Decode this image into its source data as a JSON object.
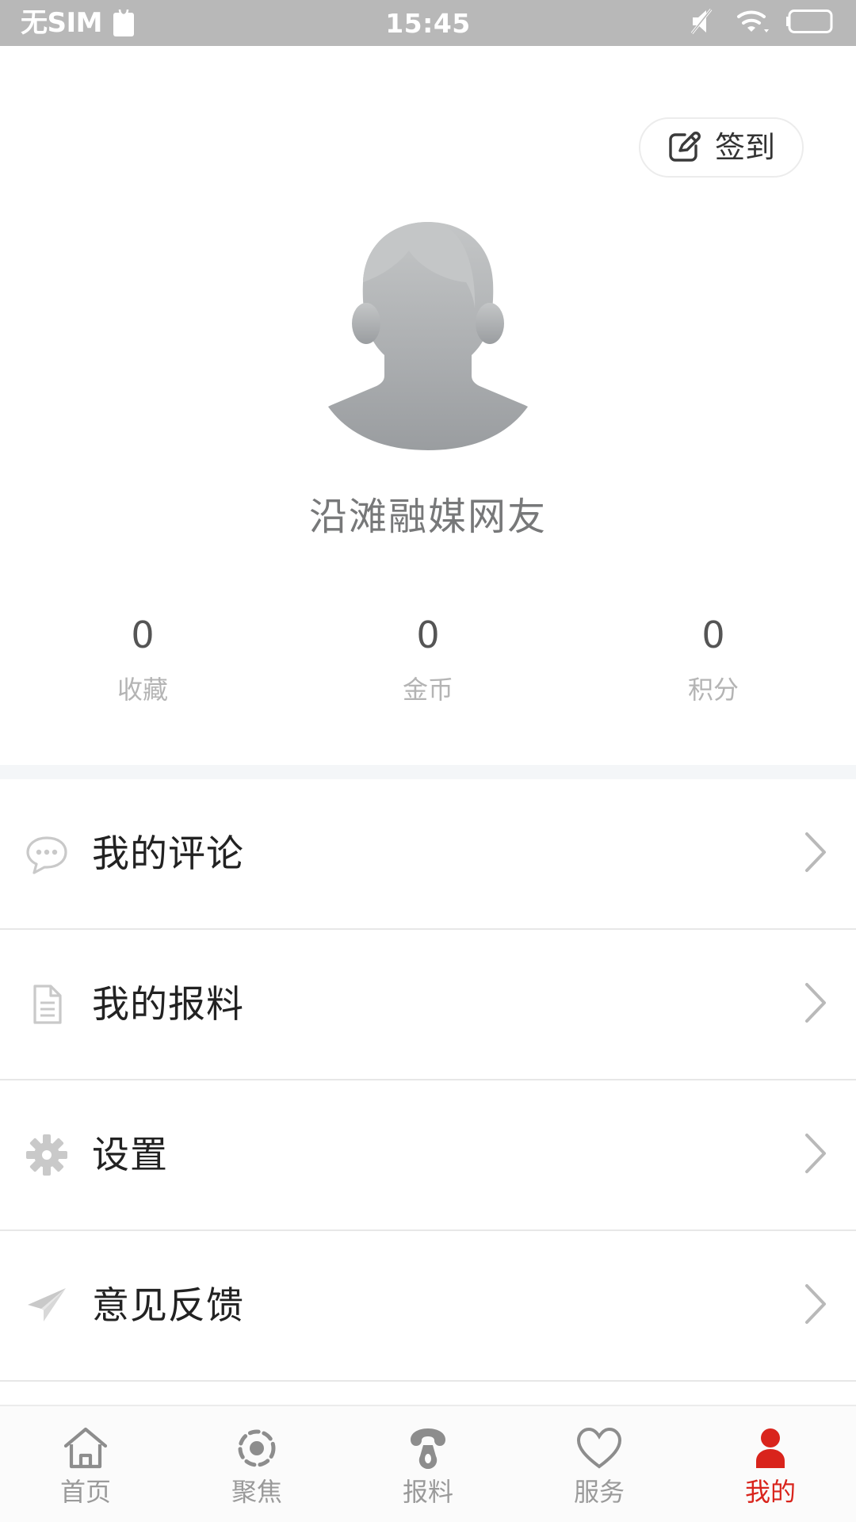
{
  "status_bar": {
    "carrier": "无SIM",
    "time": "15:45",
    "icons": [
      "sim-card-icon",
      "mute-icon",
      "wifi-icon",
      "battery-icon"
    ]
  },
  "header": {
    "signin_label": "签到",
    "signin_icon": "edit-pencil-icon"
  },
  "profile": {
    "avatar_icon": "default-avatar-silhouette",
    "username": "沿滩融媒网友",
    "stats": [
      {
        "value": "0",
        "label": "收藏"
      },
      {
        "value": "0",
        "label": "金币"
      },
      {
        "value": "0",
        "label": "积分"
      }
    ]
  },
  "menu": {
    "items": [
      {
        "label": "我的评论",
        "icon": "comment-bubble-icon"
      },
      {
        "label": "我的报料",
        "icon": "document-icon"
      },
      {
        "label": "设置",
        "icon": "gear-icon"
      },
      {
        "label": "意见反馈",
        "icon": "paper-plane-icon"
      }
    ],
    "arrow_icon": "chevron-right-icon"
  },
  "tabbar": {
    "items": [
      {
        "label": "首页",
        "icon": "home-icon",
        "active": false
      },
      {
        "label": "聚焦",
        "icon": "focus-target-icon",
        "active": false
      },
      {
        "label": "报料",
        "icon": "telephone-icon",
        "active": false
      },
      {
        "label": "服务",
        "icon": "heart-icon",
        "active": false
      },
      {
        "label": "我的",
        "icon": "person-icon",
        "active": true
      }
    ]
  },
  "colors": {
    "accent_red": "#d9241c",
    "statusbar_bg": "#b8b8b8",
    "muted_text": "#b4b4b4",
    "divider": "#e7e7e7",
    "band": "#f4f6f8"
  }
}
